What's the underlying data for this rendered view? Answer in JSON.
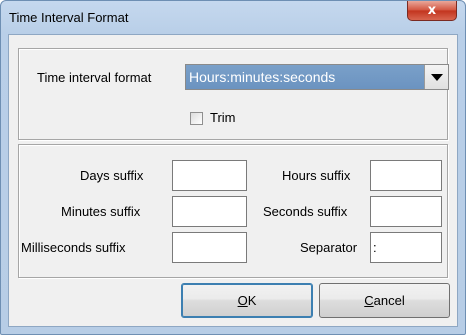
{
  "window": {
    "title": "Time Interval Format",
    "close_glyph": "x"
  },
  "format_panel": {
    "format_label": "Time interval format",
    "format_value": "Hours:minutes:seconds",
    "trim_label": "Trim",
    "trim_checked": false
  },
  "suffix_panel": {
    "days_label": "Days suffix",
    "days_value": "",
    "hours_label": "Hours suffix",
    "hours_value": "",
    "minutes_label": "Minutes suffix",
    "minutes_value": "",
    "seconds_label": "Seconds suffix",
    "seconds_value": "",
    "milliseconds_label": "Milliseconds suffix",
    "milliseconds_value": "",
    "separator_label": "Separator",
    "separator_value": ":"
  },
  "buttons": {
    "ok_mnemonic": "O",
    "ok_rest": "K",
    "cancel_mnemonic": "C",
    "cancel_rest": "ancel"
  },
  "colors": {
    "title_bar": "#b9cfe8",
    "close_button": "#c2331d",
    "combo_selected": "#6b93c0",
    "dialog_bg": "#f0f0f0"
  }
}
